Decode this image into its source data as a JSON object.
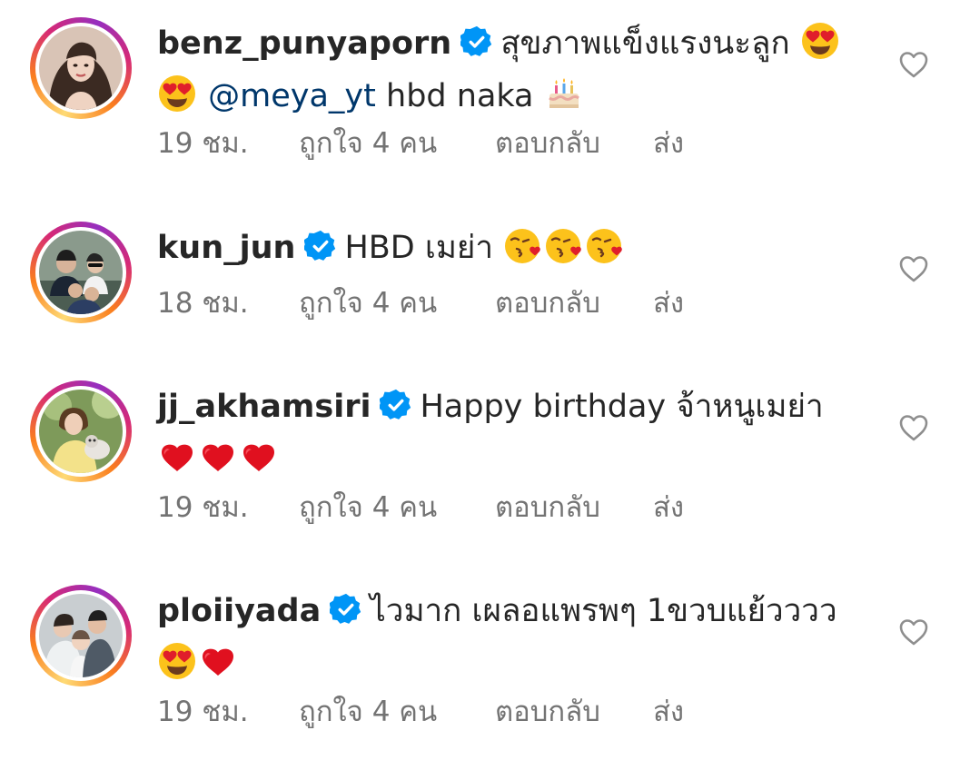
{
  "comments": [
    {
      "username": "benz_punyaporn",
      "avatar_icon": "profile-photo",
      "verified": true,
      "text_1": "สุขภาพแข็งแรงนะลูก",
      "mention": "@meya_yt",
      "text_2": "hbd naka",
      "emojis": [
        "heart-eyes-emoji",
        "heart-eyes-emoji",
        "birthday-cake-emoji"
      ],
      "time": "19 ชม.",
      "likes": "ถูกใจ 4 คน",
      "reply": "ตอบกลับ",
      "send": "ส่ง"
    },
    {
      "username": "kun_jun",
      "avatar_icon": "profile-photo",
      "verified": true,
      "text_1": "HBD เมย่า",
      "emojis": [
        "kissing-heart-emoji",
        "kissing-heart-emoji",
        "kissing-heart-emoji"
      ],
      "time": "18 ชม.",
      "likes": "ถูกใจ 4 คน",
      "reply": "ตอบกลับ",
      "send": "ส่ง"
    },
    {
      "username": "jj_akhamsiri",
      "avatar_icon": "profile-photo",
      "verified": true,
      "text_1": "Happy birthday จ้าหนูเมย่า",
      "emojis": [
        "red-heart-emoji",
        "red-heart-emoji",
        "red-heart-emoji"
      ],
      "time": "19 ชม.",
      "likes": "ถูกใจ 4 คน",
      "reply": "ตอบกลับ",
      "send": "ส่ง"
    },
    {
      "username": "ploiiyada",
      "avatar_icon": "profile-photo",
      "verified": true,
      "text_1": "ไวมาก เผลอแพรพๆ 1ขวบแย้วววว",
      "emojis": [
        "heart-eyes-emoji",
        "red-heart-emoji"
      ],
      "time": "19 ชม.",
      "likes": "ถูกใจ 4 คน",
      "reply": "ตอบกลับ",
      "send": "ส่ง"
    }
  ],
  "colors": {
    "text": "#262626",
    "secondary": "#737373",
    "mention": "#00376b",
    "verified": "#0095f6"
  }
}
